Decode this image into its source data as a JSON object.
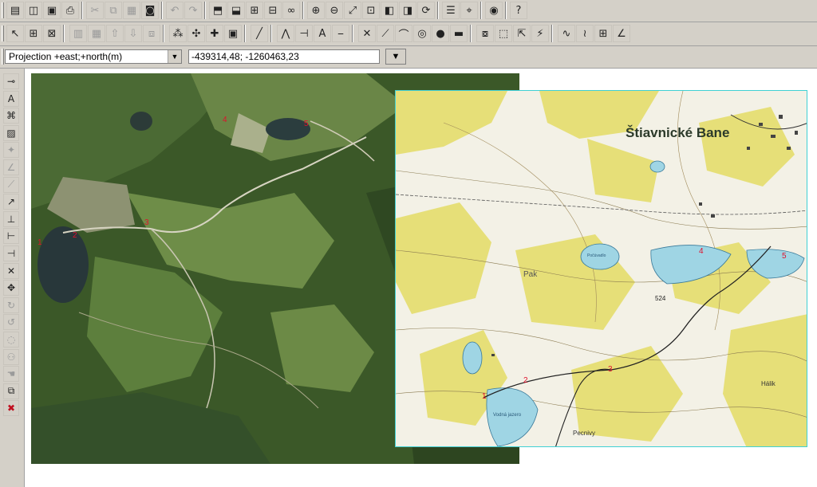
{
  "toolbar_top": {
    "icons": [
      "new-project",
      "open-project",
      "save-project",
      "print",
      "cut",
      "copy",
      "paste",
      "screenshot",
      "undo",
      "redo",
      "import-image",
      "export-image",
      "layer-add",
      "layer-props",
      "layer-link",
      "zoom-in",
      "zoom-out",
      "zoom-fit",
      "zoom-window",
      "zoom-previous",
      "zoom-next",
      "zoom-refresh",
      "properties",
      "georef",
      "globe",
      "help"
    ]
  },
  "toolbar_tools": {
    "icons": [
      "select-arrow",
      "select-grid",
      "deselect-grid",
      "table-a",
      "table-b",
      "move-up",
      "move-down",
      "merge",
      "add-point",
      "add-vertex",
      "add-node",
      "map-frame",
      "line",
      "polyline",
      "tick",
      "text-label",
      "baseline",
      "cross",
      "segment",
      "arc",
      "ring",
      "dot",
      "dash",
      "project-tool",
      "select-frame",
      "transform",
      "wand",
      "curve-a",
      "curve-b",
      "layout",
      "angle"
    ]
  },
  "projection": {
    "selected": "Projection +east;+north(m)"
  },
  "coordinates": {
    "value": "-439314,48; -1260463,23"
  },
  "left_toolbar": {
    "icons": [
      "line-tool",
      "text-tool",
      "label-tool",
      "image-tool",
      "point-tool",
      "angle-tool",
      "measure-tool",
      "arrow-tool",
      "align-tool",
      "gcp-a",
      "gcp-b",
      "delete-point",
      "pan-tool",
      "rotate-tool",
      "rotate-b",
      "lasso-tool",
      "group-tool",
      "hand-tool",
      "copy-tool",
      "close-tool"
    ]
  },
  "map": {
    "topo_title": "Štiavnické Bane",
    "topo_road": "524",
    "topo_places": [
      "Pak",
      "Počúvadlo",
      "Vodná jazero",
      "Pecnivy",
      "Hálik"
    ],
    "marker_labels": [
      "1",
      "2",
      "3",
      "4",
      "5"
    ]
  },
  "colors": {
    "toolbar": "#d4d0c8",
    "topo_border": "#3fd0d4",
    "marker": "#e0102c",
    "lake": "#9fd5e4",
    "forest": "#e6df78"
  }
}
